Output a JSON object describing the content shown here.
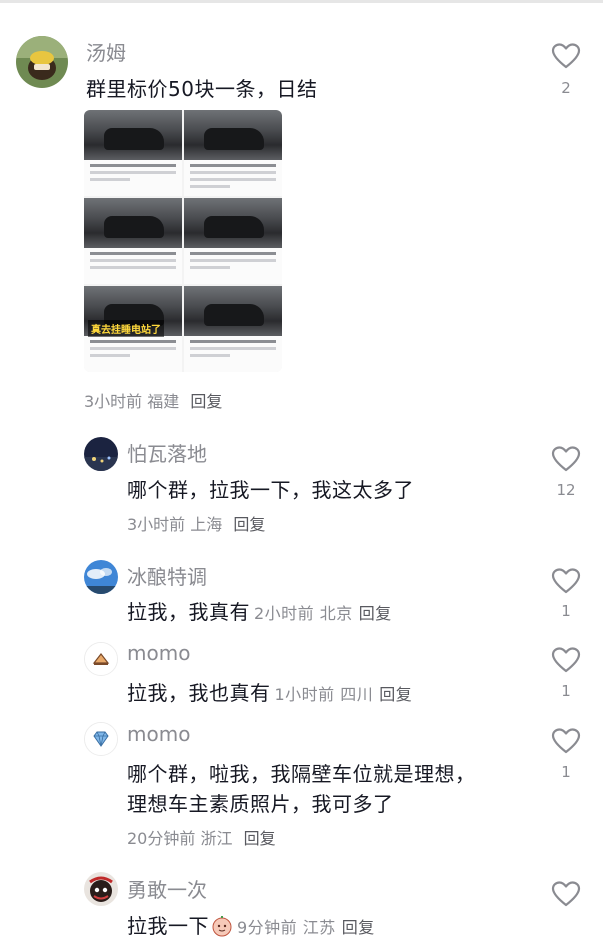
{
  "comments": [
    {
      "username": "汤姆",
      "text": "群里标价50块一条，日结",
      "time": "3小时前",
      "location": "福建",
      "reply_label": "回复",
      "likes": "2",
      "image_caption": "真去挂睡电站了"
    },
    {
      "username": "怕瓦落地",
      "text": "哪个群，拉我一下，我这太多了",
      "time": "3小时前",
      "location": "上海",
      "reply_label": "回复",
      "likes": "12"
    },
    {
      "username": "冰酿特调",
      "text": "拉我，我真有",
      "time": "2小时前",
      "location": "北京",
      "reply_label": "回复",
      "likes": "1"
    },
    {
      "username": "momo",
      "text": "拉我，我也真有",
      "time": "1小时前",
      "location": "四川",
      "reply_label": "回复",
      "likes": "1"
    },
    {
      "username": "momo",
      "text_line1": "哪个群，啦我，我隔壁车位就是理想，",
      "text_line2": "理想车主素质照片，我可多了",
      "time": "20分钟前",
      "location": "浙江",
      "reply_label": "回复",
      "likes": "1"
    },
    {
      "username": "勇敢一次",
      "text": "拉我一下",
      "time": "9分钟前",
      "location": "江苏",
      "reply_label": "回复",
      "likes": ""
    }
  ],
  "icons": {
    "like": "heart-outline-icon",
    "emoji": "emoji-sticker-icon"
  },
  "colors": {
    "text": "#161823",
    "meta": "#8a8b91",
    "heart": "#8a8b91"
  }
}
